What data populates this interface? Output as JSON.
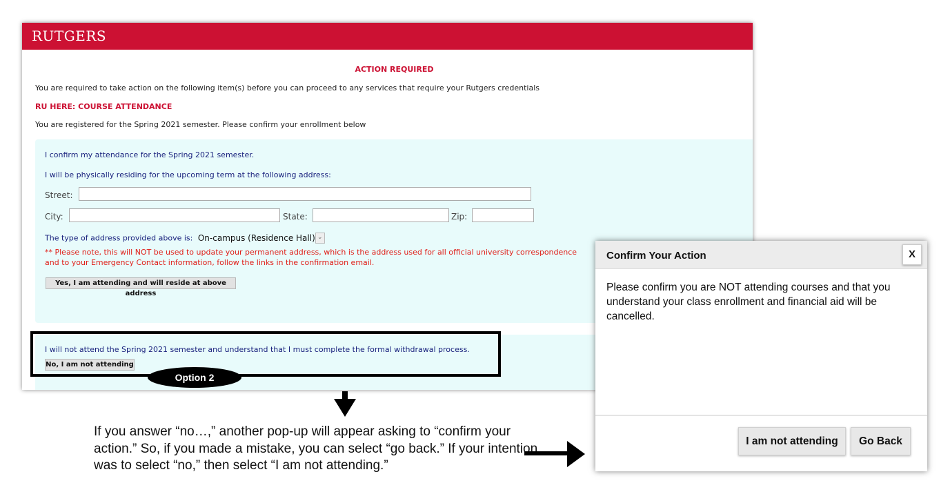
{
  "header": {
    "logo_text": "RUTGERS"
  },
  "notice": {
    "title": "ACTION REQUIRED",
    "intro": "You are required to take action on the following item(s) before you can proceed to any services that require your Rutgers credentials",
    "section_title": "RU HERE: COURSE ATTENDANCE",
    "registered_text": "You are registered for the Spring 2021 semester. Please confirm your enrollment below"
  },
  "attend_form": {
    "confirm_text": "I confirm my attendance for the Spring 2021 semester.",
    "address_prompt": "I will be physically residing for the upcoming term at the following address:",
    "street_label": "Street:",
    "street_value": "",
    "city_label": "City:",
    "city_value": "",
    "state_label": "State:",
    "state_value": "",
    "zip_label": "Zip:",
    "zip_value": "",
    "address_type_label": "The type of address provided above is:",
    "address_type_value": "On-campus (Residence Hall)",
    "warning_line1": "** Please note, this will NOT be used to update your permanent address, which is the address used for all official university correspondence",
    "warning_line2": "and to your Emergency Contact information, follow the links in the confirmation email.",
    "submit_label": "Yes, I am attending and will reside at above address"
  },
  "decline_form": {
    "text": "I will not attend the Spring 2021 semester and understand that I must complete the formal withdrawal process.",
    "button_label": "No, I am not attending"
  },
  "annotation": {
    "option_label": "Option 2",
    "explanation": "If you answer “no…,” another pop-up will appear asking to “confirm your action.” So, if you made a mistake, you can select “go back.” If your intention was to select “no,” then select “I am not attending.”"
  },
  "modal": {
    "title": "Confirm Your Action",
    "close_label": "X",
    "message": "Please confirm you are NOT attending courses and that you understand your class enrollment and financial aid will be cancelled.",
    "confirm_label": "I am not attending",
    "back_label": "Go Back"
  },
  "colors": {
    "brand_red": "#cc1133",
    "panel_bg": "#e8fbfb",
    "link_navy": "#1a237e",
    "warning_red": "#e0201a"
  }
}
